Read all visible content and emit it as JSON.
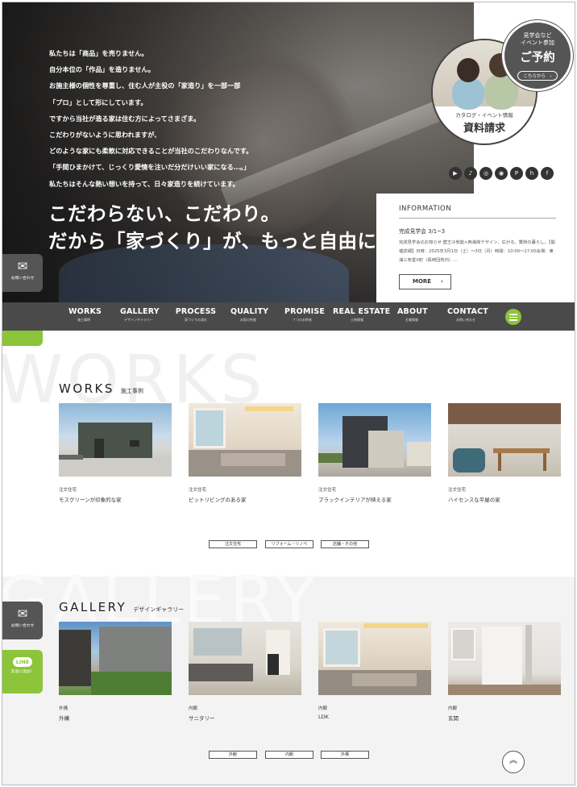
{
  "hero": {
    "message_lines": [
      "私たちは「商品」を売りません。",
      "自分本位の「作品」を造りません。",
      "お施主様の個性を尊重し、住む人が主役の「家造り」を一部一部",
      "「プロ」として形にしています。",
      "ですから当社が造る家は住む方によってさまざま。",
      "こだわりがないように思われますが、",
      "どのような家にも柔軟に対応できることが当社のこだわりなんです。",
      "「手間ひまかけて、じっくり愛情を注いだ分だけいい家になる…。」",
      "私たちはそんな熱い想いを持って、日々家造りを続けています。"
    ],
    "catch_line1": "こだわらない、こだわり。",
    "catch_line2": "だから「家づくり」が、もっと自由に。"
  },
  "reserve": {
    "line1": "見学会など",
    "line2": "イベント参加",
    "big": "ご予約",
    "btn": "こちらから　›"
  },
  "request": {
    "small": "カタログ・イベント情報",
    "big": "資料請求"
  },
  "sns": [
    {
      "icon": "youtube-icon",
      "glyph": "▶"
    },
    {
      "icon": "tiktok-icon",
      "glyph": "♪"
    },
    {
      "icon": "instagram-icon",
      "glyph": "◎"
    },
    {
      "icon": "line-icon",
      "glyph": "◉"
    },
    {
      "icon": "pinterest-icon",
      "glyph": "P"
    },
    {
      "icon": "houzz-icon",
      "glyph": "h"
    },
    {
      "icon": "facebook-icon",
      "glyph": "f"
    }
  ],
  "info": {
    "heading": "INFORMATION",
    "title": "完成見学会 3/1~3",
    "desc": "完成見学会のお知らせ 壁王冷気能×西海岸デザイン、広がる、贅隙の暮らし。【開催詳細】日時：2025年3月1日（土）～3日（月）時間：10:00～17:00会場：東浦三条堂X町（長崎団地内）...",
    "more": "MORE"
  },
  "side": {
    "mail_label": "お問い合わせ",
    "line_badge": "LINE",
    "line_label": "友達に追加！"
  },
  "nav": [
    {
      "en": "WORKS",
      "ja": "施工事例"
    },
    {
      "en": "GALLERY",
      "ja": "デザインギャラリー"
    },
    {
      "en": "PROCESS",
      "ja": "家づくりの流れ"
    },
    {
      "en": "QUALITY",
      "ja": "お家の性能"
    },
    {
      "en": "PROMISE",
      "ja": "７つのお約束"
    },
    {
      "en": "REAL ESTATE",
      "ja": "土地情報"
    },
    {
      "en": "ABOUT",
      "ja": "企業情報"
    },
    {
      "en": "CONTACT",
      "ja": "お問い合わせ"
    }
  ],
  "works": {
    "bg_word": "WORKS",
    "title_en": "WORKS",
    "title_ja": "施工事例",
    "cards": [
      {
        "cat": "注文住宅",
        "name": "モスグリーンが印象的な家"
      },
      {
        "cat": "注文住宅",
        "name": "ピットリビングのある家"
      },
      {
        "cat": "注文住宅",
        "name": "ブラックインテリアが映える家"
      },
      {
        "cat": "注文住宅",
        "name": "ハイセンスな平屋の家"
      }
    ],
    "filters": [
      "注文住宅",
      "リフォーム・リノベ",
      "店舗・その他"
    ]
  },
  "gallery": {
    "bg_word": "GALLERY",
    "title_en": "GALLERY",
    "title_ja": "デザインギャラリー",
    "cards": [
      {
        "cat": "外構",
        "name": "外構"
      },
      {
        "cat": "内観",
        "name": "サニタリー"
      },
      {
        "cat": "内観",
        "name": "LDK"
      },
      {
        "cat": "内観",
        "name": "玄関"
      }
    ],
    "filters": [
      "外観",
      "内観",
      "外構"
    ]
  },
  "totop": "︽"
}
